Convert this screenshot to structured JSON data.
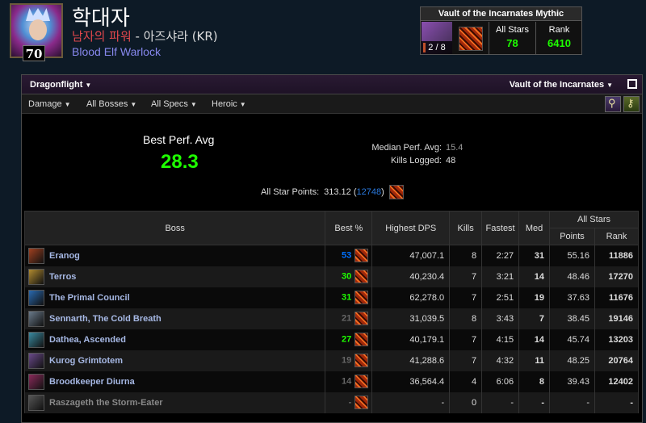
{
  "character": {
    "name": "학대자",
    "level": "70",
    "guild": "남자의 파워",
    "realm": " - 아즈샤라 (KR)",
    "class": "Blood Elf Warlock"
  },
  "vault": {
    "title": "Vault of the Incarnates Mythic",
    "progress": "2 / 8",
    "all_stars_label": "All Stars",
    "all_stars_value": "78",
    "rank_label": "Rank",
    "rank_value": "6410"
  },
  "toolbar": {
    "expansion": "Dragonflight",
    "zone": "Vault of the Incarnates",
    "metric": "Damage",
    "bosses": "All Bosses",
    "specs": "All Specs",
    "difficulty": "Heroic"
  },
  "summary": {
    "best_perf_label": "Best Perf. Avg",
    "best_perf_value": "28.3",
    "median_label": "Median Perf. Avg:",
    "median_value": "15.4",
    "kills_label": "Kills Logged:",
    "kills_value": "48",
    "all_star_label": "All Star Points:",
    "all_star_points": "313.12",
    "all_star_paren_open": "(",
    "all_star_rank": "12748",
    "all_star_paren_close": ")"
  },
  "table": {
    "headers": {
      "boss": "Boss",
      "best": "Best %",
      "dps": "Highest DPS",
      "kills": "Kills",
      "fastest": "Fastest",
      "med": "Med",
      "all_stars": "All Stars",
      "points": "Points",
      "rank": "Rank"
    },
    "rows": [
      {
        "boss": "Eranog",
        "best": "53",
        "best_color": "blue",
        "dps": "47,007.1",
        "kills": "8",
        "fastest": "2:27",
        "med": "31",
        "med_color": "green",
        "points": "55.16",
        "rank": "11886",
        "rank_color": "green"
      },
      {
        "boss": "Terros",
        "best": "30",
        "best_color": "green",
        "dps": "40,230.4",
        "kills": "7",
        "fastest": "3:21",
        "med": "14",
        "med_color": "gray",
        "points": "48.46",
        "rank": "17270",
        "rank_color": "green"
      },
      {
        "boss": "The Primal Council",
        "best": "31",
        "best_color": "green",
        "dps": "62,278.0",
        "kills": "7",
        "fastest": "2:51",
        "med": "19",
        "med_color": "gray",
        "points": "37.63",
        "rank": "11676",
        "rank_color": "green"
      },
      {
        "boss": "Sennarth, The Cold Breath",
        "best": "21",
        "best_color": "gray",
        "dps": "31,039.5",
        "kills": "8",
        "fastest": "3:43",
        "med": "7",
        "med_color": "gray",
        "points": "38.45",
        "rank": "19146",
        "rank_color": "gray"
      },
      {
        "boss": "Dathea, Ascended",
        "best": "27",
        "best_color": "green",
        "dps": "40,179.1",
        "kills": "7",
        "fastest": "4:15",
        "med": "14",
        "med_color": "gray",
        "points": "45.74",
        "rank": "13203",
        "rank_color": "green"
      },
      {
        "boss": "Kurog Grimtotem",
        "best": "19",
        "best_color": "gray",
        "dps": "41,288.6",
        "kills": "7",
        "fastest": "4:32",
        "med": "11",
        "med_color": "gray",
        "points": "48.25",
        "rank": "20764",
        "rank_color": "gray"
      },
      {
        "boss": "Broodkeeper Diurna",
        "best": "14",
        "best_color": "gray",
        "dps": "36,564.4",
        "kills": "4",
        "fastest": "6:06",
        "med": "8",
        "med_color": "gray",
        "points": "39.43",
        "rank": "12402",
        "rank_color": "gray"
      },
      {
        "boss": "Raszageth the Storm-Eater",
        "best": "-",
        "best_color": "gray",
        "dps": "-",
        "kills": "0",
        "fastest": "-",
        "med": "-",
        "med_color": "gray",
        "points": "-",
        "rank": "-",
        "rank_color": "gray",
        "dim": true
      }
    ]
  },
  "icons": {
    "spec": "destruction-spec-icon",
    "boss_colors": [
      "#a04020",
      "#b08a30",
      "#2a6ab0",
      "#6a7a8a",
      "#3a8aa0",
      "#6a4a8a",
      "#8a2a5a",
      "#555555"
    ]
  },
  "colors": {
    "green": "#1eff00",
    "blue": "#0070ff",
    "gray": "#666666",
    "guild_red": "#e0474c",
    "warlock": "#8788ee"
  }
}
